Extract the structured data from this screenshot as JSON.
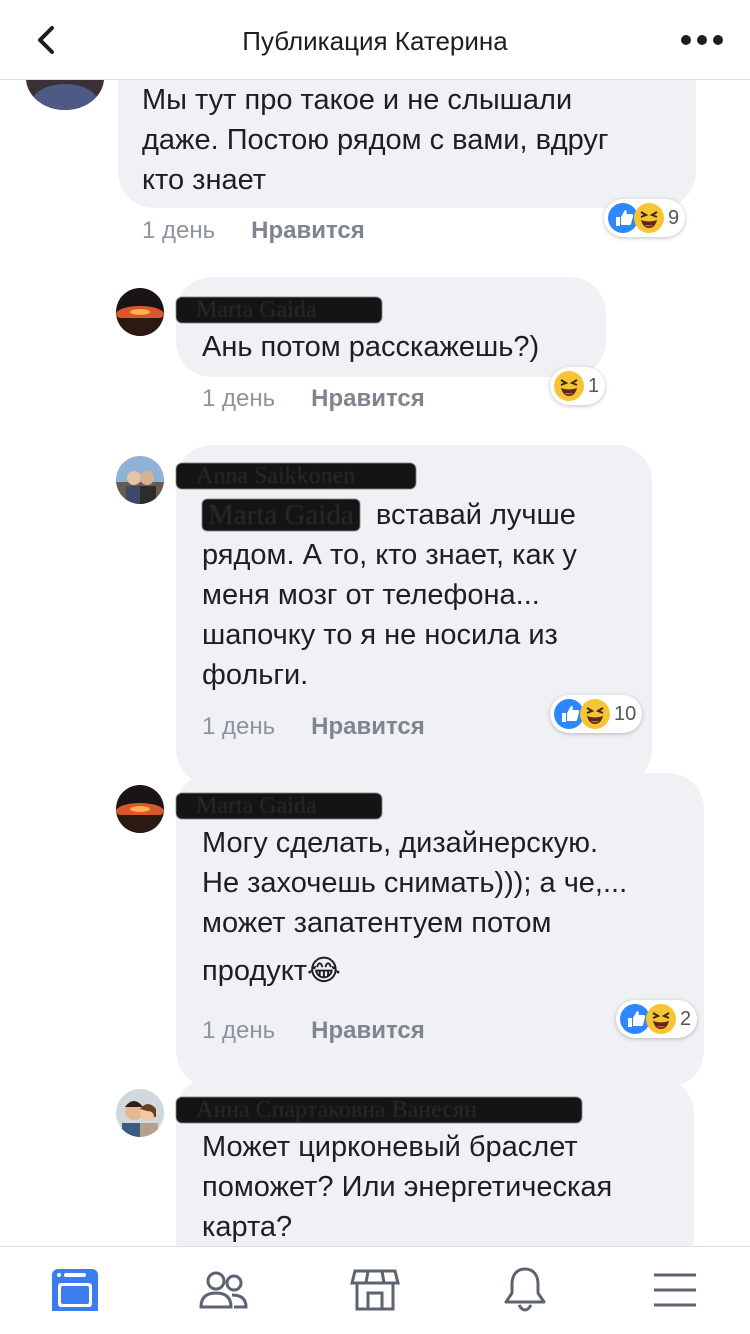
{
  "header": {
    "title": "Публикация Катерина",
    "back_icon": "chevron-left-icon",
    "more_icon": "more-dots-icon"
  },
  "comments": [
    {
      "author": "",
      "text": [
        "Мы тут про такое и не слышали",
        "даже. Постою рядом с вами, вдруг",
        "кто знает"
      ],
      "time": "1 день",
      "like": "Нравится",
      "reactions": [
        "like",
        "haha"
      ],
      "reaction_count": "9"
    },
    {
      "author": "Marta Gaida",
      "text": [
        "Ань потом расскажешь?)"
      ],
      "time": "1 день",
      "like": "Нравится",
      "reactions": [
        "haha"
      ],
      "reaction_count": "1"
    },
    {
      "author": "Anna Saikkonen",
      "mention": "Marta Gaida",
      "text": [
        "вставай лучше",
        "рядом. А то, кто знает, как у",
        "меня мозг от телефона...",
        "шапочку то я не носила из",
        "фольги."
      ],
      "time": "1 день",
      "like": "Нравится",
      "reactions": [
        "like",
        "haha"
      ],
      "reaction_count": "10"
    },
    {
      "author": "Marta Gaida",
      "text": [
        "Могу сделать, дизайнерскую.",
        "Не захочешь снимать))); а че,...",
        "может запатентуем потом",
        "продукт"
      ],
      "trailing_emoji": "😂",
      "time": "1 день",
      "like": "Нравится",
      "reactions": [
        "like",
        "haha"
      ],
      "reaction_count": "2"
    },
    {
      "author": "Анна Спартаковна Ванесян",
      "text": [
        "Может цирконевый браслет",
        "поможет? Или энергетическая",
        "карта?"
      ]
    }
  ],
  "tabbar": {
    "items": [
      "news-feed-icon",
      "friends-icon",
      "marketplace-icon",
      "notifications-icon",
      "menu-icon"
    ],
    "active_color": "#3b7ded"
  },
  "colors": {
    "like_blue": "#2d88ff",
    "haha_yellow": "#f7c533",
    "bubble": "#f0f1f4"
  }
}
